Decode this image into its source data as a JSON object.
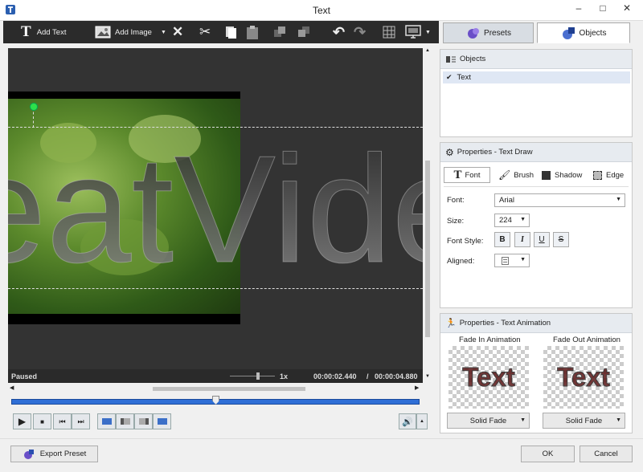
{
  "window": {
    "title": "Text",
    "minimize": "–",
    "maximize": "□",
    "close": "✕"
  },
  "toolbar": {
    "add_text": "Add Text",
    "add_image": "Add Image"
  },
  "tabs": {
    "presets": "Presets",
    "objects": "Objects"
  },
  "canvas": {
    "sample_text": "eatVide"
  },
  "status": {
    "state": "Paused",
    "speed": "1x",
    "current_time": "00:00:02.440",
    "separator": "/",
    "total_time": "00:00:04.880"
  },
  "timeline": {
    "position": 0.5
  },
  "objects_panel": {
    "title": "Objects",
    "items": [
      {
        "label": "Text",
        "checked": true
      }
    ]
  },
  "text_draw": {
    "title": "Properties - Text Draw",
    "tabs": {
      "font": "Font",
      "brush": "Brush",
      "shadow": "Shadow",
      "edge": "Edge"
    },
    "font_label": "Font:",
    "font_value": "Arial",
    "size_label": "Size:",
    "size_value": "224",
    "style_label": "Font Style:",
    "styles": {
      "bold": "B",
      "italic": "I",
      "underline": "U",
      "strike": "S"
    },
    "aligned_label": "Aligned:"
  },
  "text_anim": {
    "title": "Properties - Text Animation",
    "fade_in_label": "Fade In Animation",
    "fade_out_label": "Fade Out Animation",
    "preview_text": "Text",
    "fade_in_value": "Solid Fade",
    "fade_out_value": "Solid Fade"
  },
  "footer": {
    "export": "Export Preset",
    "ok": "OK",
    "cancel": "Cancel"
  },
  "colors": {
    "accent": "#2f6fd6",
    "toolbar": "#2b2b2b",
    "panel_head": "#e7ebf0"
  }
}
